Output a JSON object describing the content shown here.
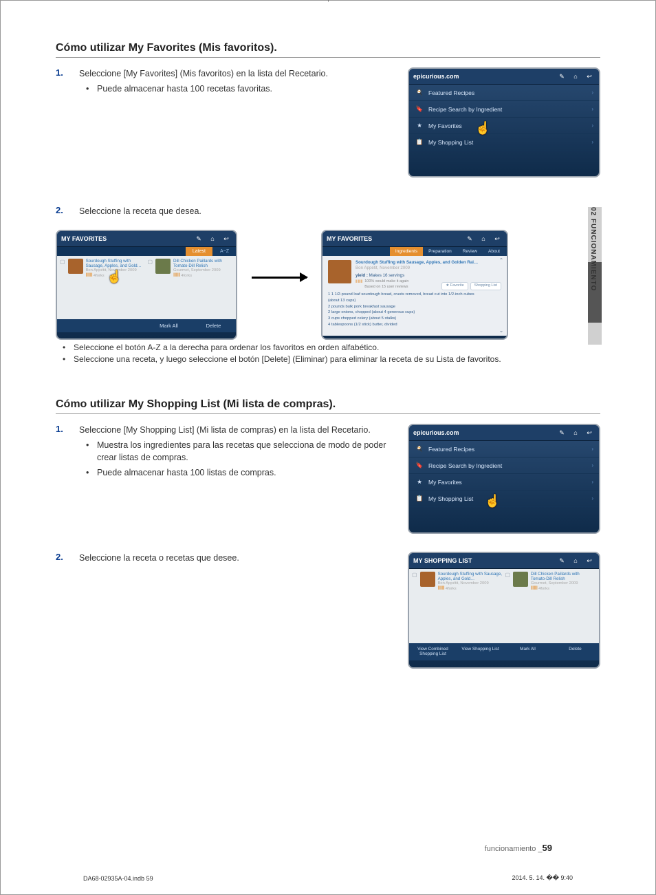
{
  "section1": {
    "title": "Cómo utilizar My Favorites (Mis favoritos).",
    "step1_num": "1.",
    "step1_text": "Seleccione [My Favorites] (Mis favoritos) en la lista del Recetario.",
    "step1_bullet1": "Puede almacenar hasta 100 recetas favoritas.",
    "step2_num": "2.",
    "step2_text": "Seleccione la receta que desea.",
    "note_bullet1": "Seleccione el botón A-Z a la derecha para ordenar los favoritos en orden alfabético.",
    "note_bullet2": "Seleccione una receta, y luego seleccione el botón [Delete] (Eliminar) para eliminar la receta de su Lista de favoritos."
  },
  "section2": {
    "title": "Cómo utilizar My Shopping List (Mi lista de compras).",
    "step1_num": "1.",
    "step1_text": "Seleccione [My Shopping List] (Mi lista de compras) en la lista del Recetario.",
    "step1_bullet1": "Muestra los ingredientes para las recetas que selecciona de modo de poder crear listas de compras.",
    "step1_bullet2": "Puede almacenar hasta 100 listas de compras.",
    "step2_num": "2.",
    "step2_text": "Seleccione la receta o recetas que desee."
  },
  "appui": {
    "site": "epicurious.com",
    "menu_featured": "Featured Recipes",
    "menu_search": "Recipe Search by Ingredient",
    "menu_fav": "My Favorites",
    "menu_shop": "My Shopping List",
    "icon_edit": "✎",
    "icon_home": "⌂",
    "icon_back": "↩",
    "chev": "›"
  },
  "favscreen": {
    "title": "MY FAVORITES",
    "tab_latest": "Latest",
    "tab_az": "A~Z",
    "recipe1_title": "Sourdough Stuffing with Sausage, Apples, and Gold…",
    "recipe1_sub": "Bon Appétit, November 2009",
    "recipe2_title": "Dill Chicken Paillards with Tomato-Dill Relish",
    "recipe2_sub": "Gourmet, September 2009",
    "forks": "‖‖‖‖",
    "forks_lbl": "4forks",
    "btn_markall": "Mark All",
    "btn_delete": "Delete"
  },
  "detailscreen": {
    "title": "MY FAVORITES",
    "tab_ing": "Ingredients",
    "tab_prep": "Preparation",
    "tab_rev": "Review",
    "tab_about": "About",
    "rtitle": "Sourdough Stuffing with Sausage, Apples, and Golden Rai…",
    "rsub": "Bon Appétit, November 2009",
    "yield_lbl": "yield :",
    "yield_val": "Makes 16 servings",
    "rating_line": "100% would make it again\nBased on 15 user reviews",
    "pill_fav": "★ Favorite",
    "pill_shop": "Shopping List",
    "ing1": "1 1 1/2-pound loaf sourdough bread, crusts removed, bread cut into 1/2-inch cubes",
    "ing2": "(about 13 cups)",
    "ing3": "2 pounds bulk pork breakfast sausage",
    "ing4": "2 large onions, chopped (about 4 generous cups)",
    "ing5": "3 cups chopped celery (about 5 stalks)",
    "ing6": "4 tablespoons (1/2 stick) butter, divided"
  },
  "shoplistscreen": {
    "title": "MY SHOPPING LIST",
    "btn_combined": "View Combined Shopping List",
    "btn_view": "View Shopping List",
    "btn_markall": "Mark All",
    "btn_delete": "Delete"
  },
  "sidetab": "02  FUNCIONAMIENTO",
  "footer_label": "funcionamiento _",
  "footer_page": "59",
  "printleft": "DA68-02935A-04.indb   59",
  "printright": "2014. 5. 14.   �� 9:40"
}
